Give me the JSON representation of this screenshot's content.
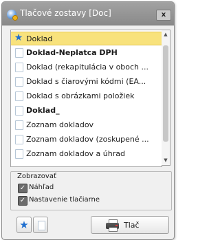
{
  "window": {
    "title": "Tlačové zostavy [Doc]",
    "close_label": "x"
  },
  "list": {
    "items": [
      {
        "label": "Doklad",
        "icon": "star-icon",
        "bold": false,
        "selected": true
      },
      {
        "label": "Doklad-Neplatca DPH",
        "icon": "document-icon",
        "bold": true,
        "selected": false
      },
      {
        "label": "Doklad (rekapitulácia v oboch ...",
        "icon": "document-icon",
        "bold": false,
        "selected": false
      },
      {
        "label": "Doklad s čiarovými kódmi (EA...",
        "icon": "document-icon",
        "bold": false,
        "selected": false
      },
      {
        "label": "Doklad s obrázkami položiek",
        "icon": "document-icon",
        "bold": false,
        "selected": false
      },
      {
        "label": "Doklad_",
        "icon": "document-icon",
        "bold": true,
        "selected": false
      },
      {
        "label": "Zoznam dokladov",
        "icon": "document-icon",
        "bold": false,
        "selected": false
      },
      {
        "label": "Zoznam dokladov (zoskupené ...",
        "icon": "document-icon",
        "bold": false,
        "selected": false
      },
      {
        "label": "Zoznam dokladov a úhrad",
        "icon": "document-icon",
        "bold": false,
        "selected": false
      }
    ]
  },
  "display_group": {
    "title": "Zobrazovať",
    "preview": {
      "label": "Náhľad",
      "checked": true
    },
    "printer_settings": {
      "label": "Nastavenie tlačiarne",
      "checked": true
    }
  },
  "toolbar": {
    "favorite_icon": "star-icon",
    "document_icon": "document-icon",
    "print_label": "Tlač",
    "print_icon": "printer-icon"
  },
  "colors": {
    "selection": "#f8e27c",
    "star": "#1f6fcf",
    "titlebar": "#959595"
  }
}
